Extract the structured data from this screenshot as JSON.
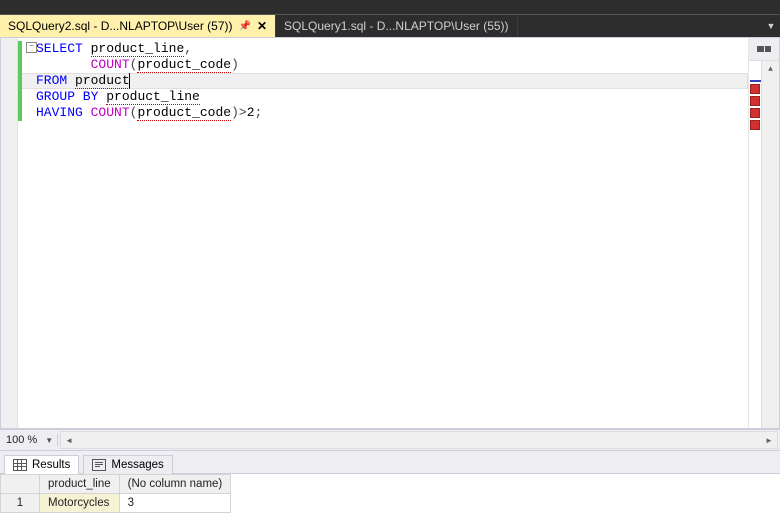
{
  "tabs": [
    {
      "label": "SQLQuery2.sql - D...NLAPTOP\\User (57))",
      "active": true,
      "pinned": true,
      "closeable": true
    },
    {
      "label": "SQLQuery1.sql - D...NLAPTOP\\User (55))",
      "active": false,
      "pinned": false,
      "closeable": false
    }
  ],
  "sql": {
    "select_kw": "SELECT",
    "select_col1": "product_line",
    "count_fn": "COUNT",
    "count_arg": "product_code",
    "from_kw": "FROM",
    "from_table": "product",
    "groupby_kw": "GROUP BY",
    "groupby_col": "product_line",
    "having_kw": "HAVING",
    "having_fn": "COUNT",
    "having_arg": "product_code",
    "having_op": ">",
    "having_val": "2",
    "semi": ";",
    "comma": ",",
    "lpar": "(",
    "rpar": ")"
  },
  "zoom": {
    "value": "100 %"
  },
  "results": {
    "tab_results": "Results",
    "tab_messages": "Messages",
    "columns": [
      "product_line",
      "(No column name)"
    ],
    "row_index": "1",
    "rows": [
      {
        "c0": "Motorcycles",
        "c1": "3"
      }
    ]
  },
  "chart_data": {
    "type": "table",
    "title": "Query Results",
    "columns": [
      "product_line",
      "(No column name)"
    ],
    "rows": [
      [
        "Motorcycles",
        3
      ]
    ]
  }
}
